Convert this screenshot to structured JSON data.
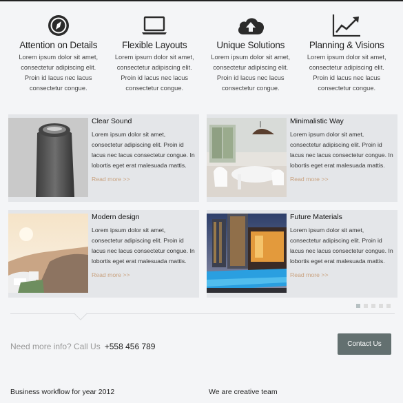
{
  "features": [
    {
      "icon": "compass-icon",
      "title": "Attention on Details",
      "text": "Lorem ipsum dolor sit amet, consectetur adipiscing elit. Proin id lacus nec lacus consectetur congue."
    },
    {
      "icon": "laptop-icon",
      "title": "Flexible Layouts",
      "text": "Lorem ipsum dolor sit amet, consectetur adipiscing elit. Proin id lacus nec lacus consectetur congue."
    },
    {
      "icon": "cloud-upload-icon",
      "title": "Unique Solutions",
      "text": "Lorem ipsum dolor sit amet, consectetur adipiscing elit. Proin id lacus nec lacus consectetur congue."
    },
    {
      "icon": "chart-up-icon",
      "title": "Planning & Visions",
      "text": "Lorem ipsum dolor sit amet, consectetur adipiscing elit. Proin id lacus nec lacus consectetur congue."
    }
  ],
  "cards": [
    {
      "title": "Clear Sound",
      "text": "Lorem ipsum dolor sit amet, consectetur adipiscing elit. Proin id lacus nec lacus consectetur congue. In lobortis eget erat malesuada mattis.",
      "more": "Read more >>"
    },
    {
      "title": "Minimalistic Way",
      "text": "Lorem ipsum dolor sit amet, consectetur adipiscing elit. Proin id lacus nec lacus consectetur congue. In lobortis eget erat malesuada mattis.",
      "more": "Read more >>"
    },
    {
      "title": "Modern design",
      "text": "Lorem ipsum dolor sit amet, consectetur adipiscing elit. Proin id lacus nec lacus consectetur congue. In lobortis eget erat malesuada mattis.",
      "more": "Read more >>"
    },
    {
      "title": "Future Materials",
      "text": "Lorem ipsum dolor sit amet, consectetur adipiscing elit. Proin id lacus nec lacus consectetur congue. In lobortis eget erat malesuada mattis.",
      "more": "Read more >>"
    }
  ],
  "pager": {
    "pages": 5,
    "active": 1
  },
  "cta": {
    "prompt": "Need more info? Call Us",
    "phone": "+558 456 789",
    "button": "Contact Us"
  },
  "footer": {
    "left_heading": "Business workflow for year 2012",
    "right_heading": "We are creative team"
  },
  "colors": {
    "accent": "#c9a27f",
    "button": "#637070",
    "card_bg": "#e4e6e9"
  }
}
